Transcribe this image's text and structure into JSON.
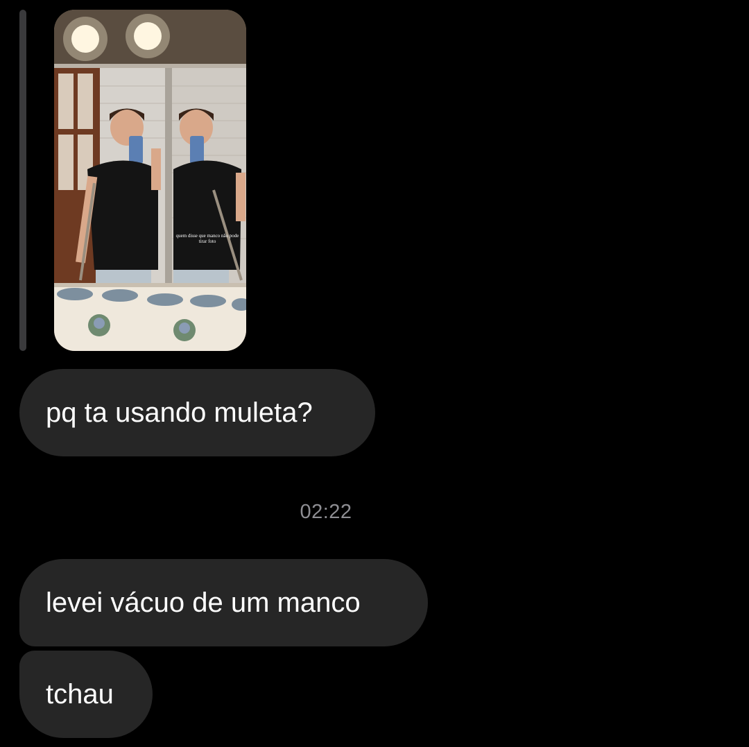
{
  "conversation": {
    "story_reply": {
      "image_caption": "quem disse que manco não pode tirar foto"
    },
    "messages": [
      {
        "text": "pq ta usando muleta?"
      },
      {
        "text": "levei vácuo de um manco"
      },
      {
        "text": "tchau"
      }
    ],
    "timestamp": "02:22"
  },
  "colors": {
    "background": "#000000",
    "bubble": "#262626",
    "timestamp": "#8e8e93",
    "reply_bar": "#3a3a3c"
  }
}
